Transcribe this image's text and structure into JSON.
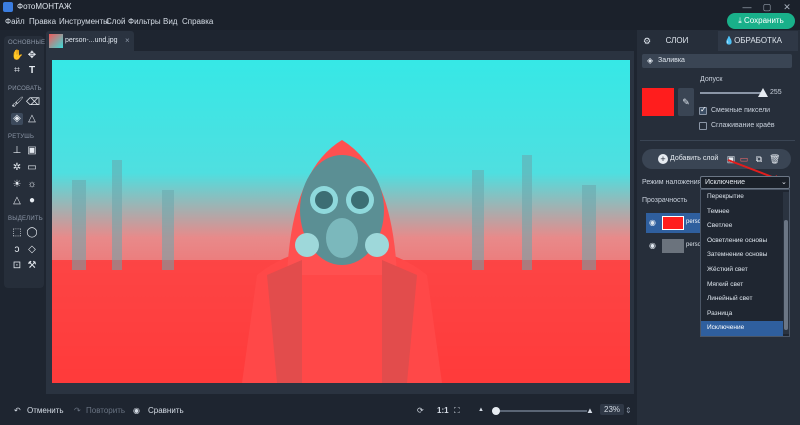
{
  "app": {
    "title": "ФотоМОНТАЖ",
    "window_controls": [
      "—",
      "▢",
      "✕"
    ]
  },
  "menu": [
    "Файл",
    "Правка",
    "Инструменты",
    "Слой",
    "Фильтры",
    "Вид",
    "Справка"
  ],
  "save_button": "Сохранить",
  "left_panel": {
    "sections": [
      {
        "label": "ОСНОВНЫЕ",
        "tools": [
          "hand-icon",
          "move-icon",
          "crop-icon",
          "text-icon"
        ]
      },
      {
        "label": "РИСОВАТЬ",
        "tools": [
          "brush-icon",
          "eraser-icon",
          "fill-bucket-icon",
          "shapes-icon"
        ]
      },
      {
        "label": "РЕТУШЬ",
        "tools": [
          "stamp-icon",
          "patch-icon",
          "healing-icon",
          "blur-icon",
          "dodge-icon",
          "burn-icon",
          "sharpen-icon",
          "drop-icon"
        ]
      },
      {
        "label": "ВЫДЕЛИТЬ",
        "tools": [
          "rect-select-icon",
          "ellipse-select-icon",
          "lasso-icon",
          "poly-lasso-icon",
          "quick-select-icon",
          "magic-wand-icon"
        ]
      }
    ]
  },
  "document_tab": {
    "name": "person-...und.jpg",
    "close": "×"
  },
  "bottom_bar": {
    "undo": "Отменить",
    "redo": "Повторить",
    "compare": "Сравнить",
    "actual_size": "1:1",
    "zoom": "23%"
  },
  "right_panel": {
    "tabs": [
      "СЛОИ",
      "ОБРАБОТКА"
    ],
    "fill_title": "Заливка",
    "tolerance_label": "Допуск",
    "tolerance_value": "255",
    "contiguous_label": "Смежные пиксели",
    "antialias_label": "Сглаживание краёв",
    "add_layer": "Добавить слой",
    "blend_mode_label": "Режим наложения:",
    "blend_mode_value": "Исключение",
    "opacity_label": "Прозрачность",
    "layers": [
      "perso",
      "perso"
    ],
    "blend_options": [
      "Перекрытие",
      "Темнее",
      "Светлее",
      "Осветление основы",
      "Затемнение основы",
      "Жёсткий свет",
      "Мягкий свет",
      "Линейный свет",
      "Разница",
      "Исключение"
    ]
  },
  "colors": {
    "accent_green": "#19b08a",
    "fill_color": "#ff1d1d",
    "selection_blue": "#2f5f9e"
  }
}
